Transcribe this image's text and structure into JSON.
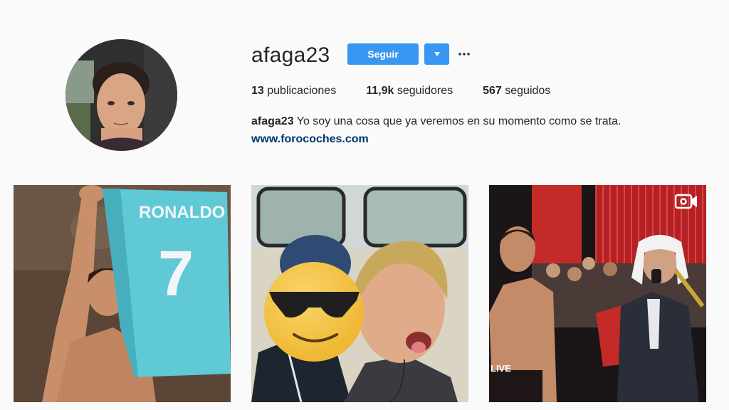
{
  "profile": {
    "username": "afaga23",
    "follow_label": "Seguir",
    "stats": {
      "posts_count": "13",
      "posts_label": "publicaciones",
      "followers_count": "11,9k",
      "followers_label": "seguidores",
      "following_count": "567",
      "following_label": "seguidos"
    },
    "bio_name": "afaga23",
    "bio_text": "Yo soy una cosa que ya veremos en su momento como se trata.",
    "website": "www.forocoches.com"
  },
  "posts": [
    {
      "jersey_name": "RONALDO",
      "jersey_number": "7",
      "type": "photo"
    },
    {
      "type": "photo",
      "overlay": "sunglasses-emoji"
    },
    {
      "type": "video",
      "banner_text": "LIVE"
    }
  ],
  "colors": {
    "accent": "#3897f0",
    "link": "#003569",
    "background": "#fafafa"
  }
}
